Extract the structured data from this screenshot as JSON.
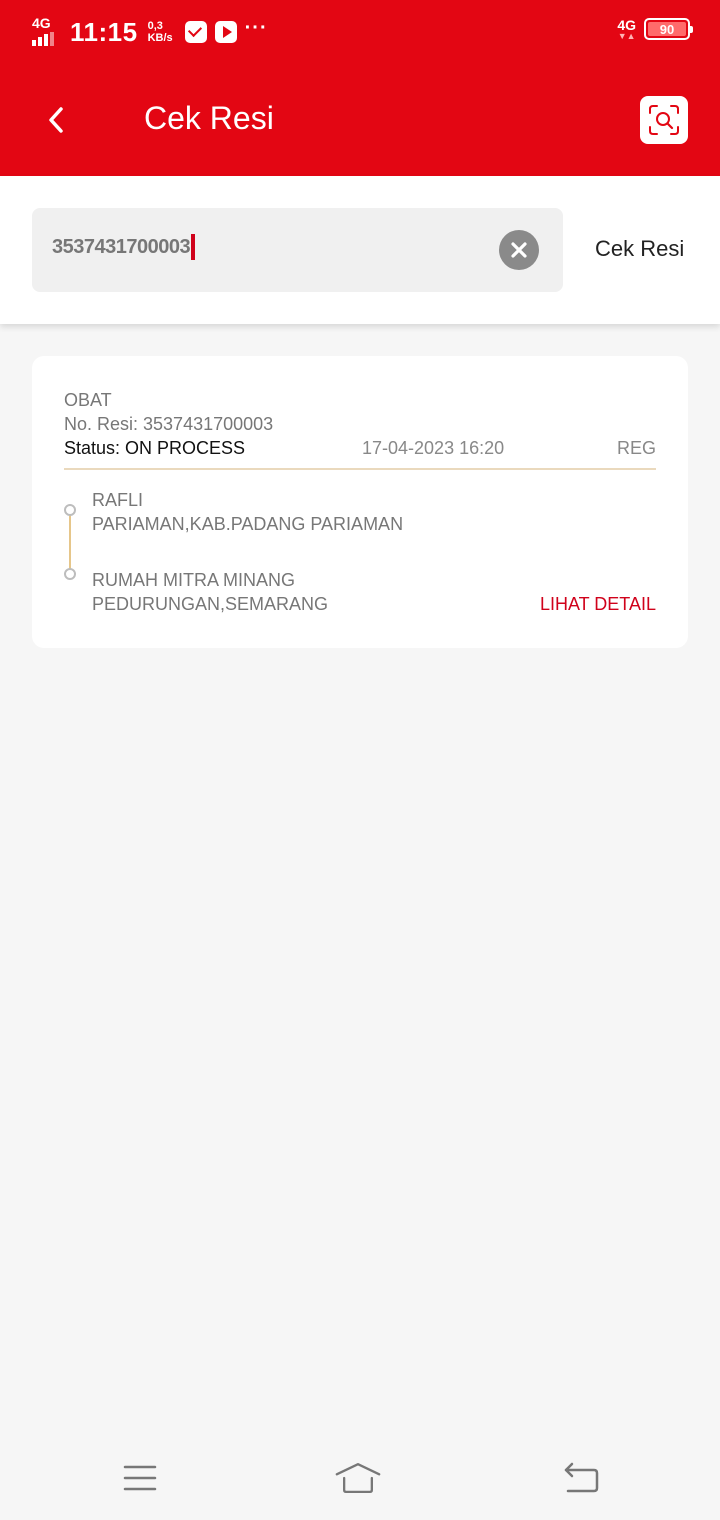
{
  "status_bar": {
    "network_left": "4G",
    "time": "11:15",
    "speed_value": "0,3",
    "speed_unit": "KB/s",
    "more": "···",
    "network_right": "4G",
    "battery": "90"
  },
  "header": {
    "title": "Cek Resi",
    "background_color": "#e30613"
  },
  "search": {
    "value": "3537431700003",
    "button_label": "Cek Resi"
  },
  "result": {
    "category": "OBAT",
    "resi_label": "No. Resi: 3537431700003",
    "status": "Status: ON PROCESS",
    "date": "17-04-2023 16:20",
    "service": "REG",
    "sender_name": "RAFLI",
    "sender_address": "PARIAMAN,KAB.PADANG PARIAMAN",
    "receiver_name": "RUMAH MITRA MINANG",
    "receiver_address": "PEDURUNGAN,SEMARANG",
    "detail_label": "LIHAT DETAIL"
  },
  "icons": {
    "back": "chevron-left-icon",
    "scan": "scan-search-icon",
    "clear": "close-circle-icon",
    "menu": "menu-icon",
    "home": "home-icon",
    "back_nav": "back-icon"
  }
}
